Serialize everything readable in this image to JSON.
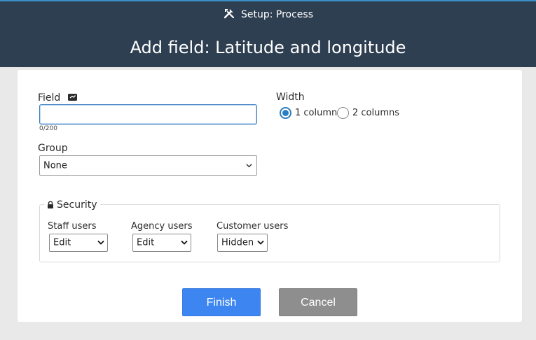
{
  "header": {
    "breadcrumb": "Setup: Process",
    "title": "Add field: Latitude and longitude",
    "icon": "tools-icon"
  },
  "form": {
    "field_label": "Field",
    "field_value": "",
    "field_counter": "0/200",
    "group_label": "Group",
    "group_value": "None",
    "width_label": "Width",
    "width_options": [
      "1 column",
      "2 columns"
    ],
    "width_selected": "1 column"
  },
  "security": {
    "legend": "Security",
    "columns": [
      {
        "label": "Staff users",
        "value": "Edit"
      },
      {
        "label": "Agency users",
        "value": "Edit"
      },
      {
        "label": "Customer users",
        "value": "Hidden"
      }
    ]
  },
  "actions": {
    "finish_label": "Finish",
    "cancel_label": "Cancel"
  },
  "colors": {
    "header_bg": "#2e3f52",
    "primary": "#3d86f2",
    "secondary": "#8e8e8e",
    "radio_accent": "#2b7fc1"
  }
}
